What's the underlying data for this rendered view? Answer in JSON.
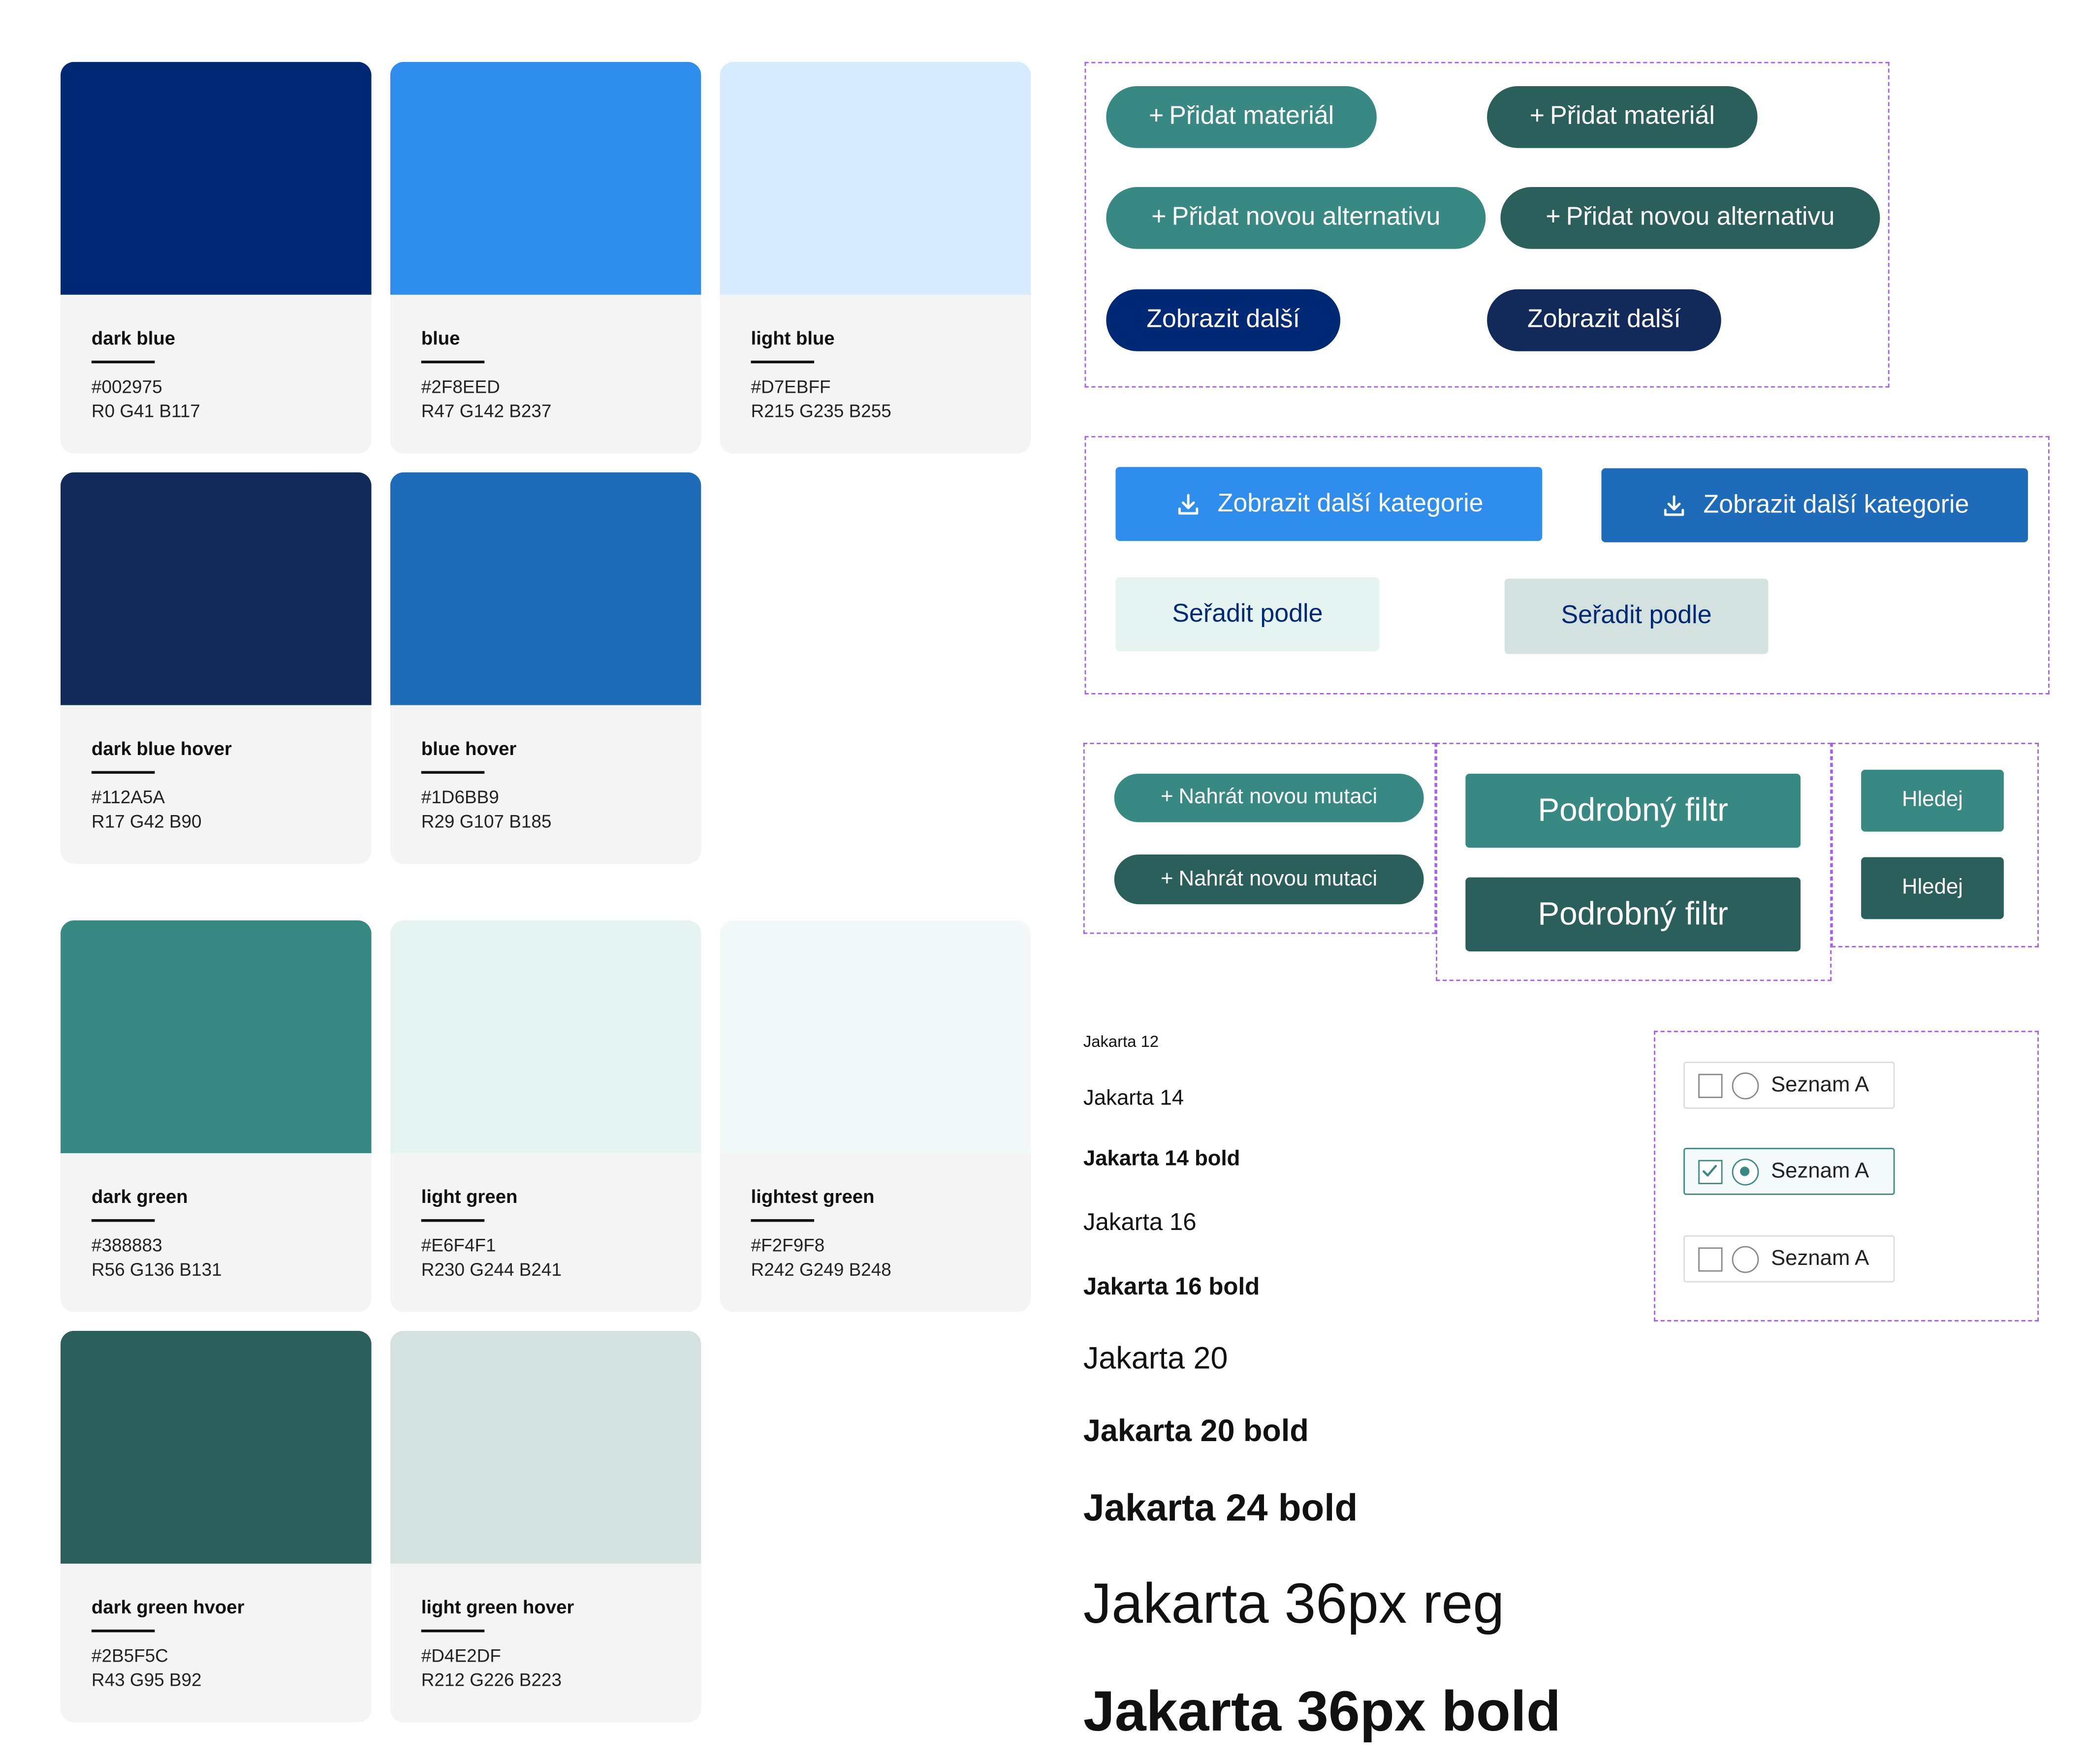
{
  "swatches": [
    {
      "name": "dark blue",
      "hex": "#002975",
      "rgb": "R0 G41 B117",
      "color": "#002975"
    },
    {
      "name": "blue",
      "hex": "#2F8EED",
      "rgb": "R47 G142 B237",
      "color": "#2f8eed"
    },
    {
      "name": "light blue",
      "hex": "#D7EBFF",
      "rgb": "R215 G235 B255",
      "color": "#d7ebff"
    },
    {
      "name": "dark blue hover",
      "hex": "#112A5A",
      "rgb": "R17 G42 B90",
      "color": "#112a5a"
    },
    {
      "name": "blue hover",
      "hex": "#1D6BB9",
      "rgb": "R29 G107 B185",
      "color": "#1d6bb9"
    },
    {
      "name": "dark green",
      "hex": "#388883",
      "rgb": "R56 G136 B131",
      "color": "#388883"
    },
    {
      "name": "light green",
      "hex": "#E6F4F1",
      "rgb": "R230 G244 B241",
      "color": "#e6f4f1"
    },
    {
      "name": "lightest green",
      "hex": "#F2F9F8",
      "rgb": "R242 G249 B248",
      "color": "#f2f9f8"
    },
    {
      "name": "dark green hvoer",
      "hex": "#2B5F5C",
      "rgb": "R43 G95 B92",
      "color": "#2b5f5c"
    },
    {
      "name": "light green hover",
      "hex": "#D4E2DF",
      "rgb": "R212 G226 B223",
      "color": "#d4e2df"
    }
  ],
  "buttons": {
    "plus": "+",
    "pridat_material": "Přidat materiál",
    "pridat_alternativu": "Přidat novou alternativu",
    "zobrazit_dalsi": "Zobrazit další",
    "zobrazit_kategorie": "Zobrazit další kategorie",
    "seradit": "Seřadit podle",
    "nahrat_mutaci": "Nahrát novou mutaci",
    "podrobny_filtr": "Podrobný filtr",
    "hledej": "Hledej"
  },
  "typography": [
    "Jakarta 12",
    "Jakarta 14",
    "Jakarta 14 bold",
    "Jakarta 16",
    "Jakarta 16 bold",
    "Jakarta 20",
    "Jakarta 20 bold",
    "Jakarta 24 bold",
    "Jakarta 36px reg",
    "Jakarta 36px bold"
  ],
  "options": [
    {
      "label": "Seznam A",
      "checked": false
    },
    {
      "label": "Seznam A",
      "checked": true
    },
    {
      "label": "Seznam A",
      "checked": false
    }
  ],
  "colors": {
    "accent_border": "#a45cf2",
    "sort_bg": "#e6f4f1",
    "sort_bg_hover": "#d4e2df",
    "sort_text": "#002975"
  }
}
